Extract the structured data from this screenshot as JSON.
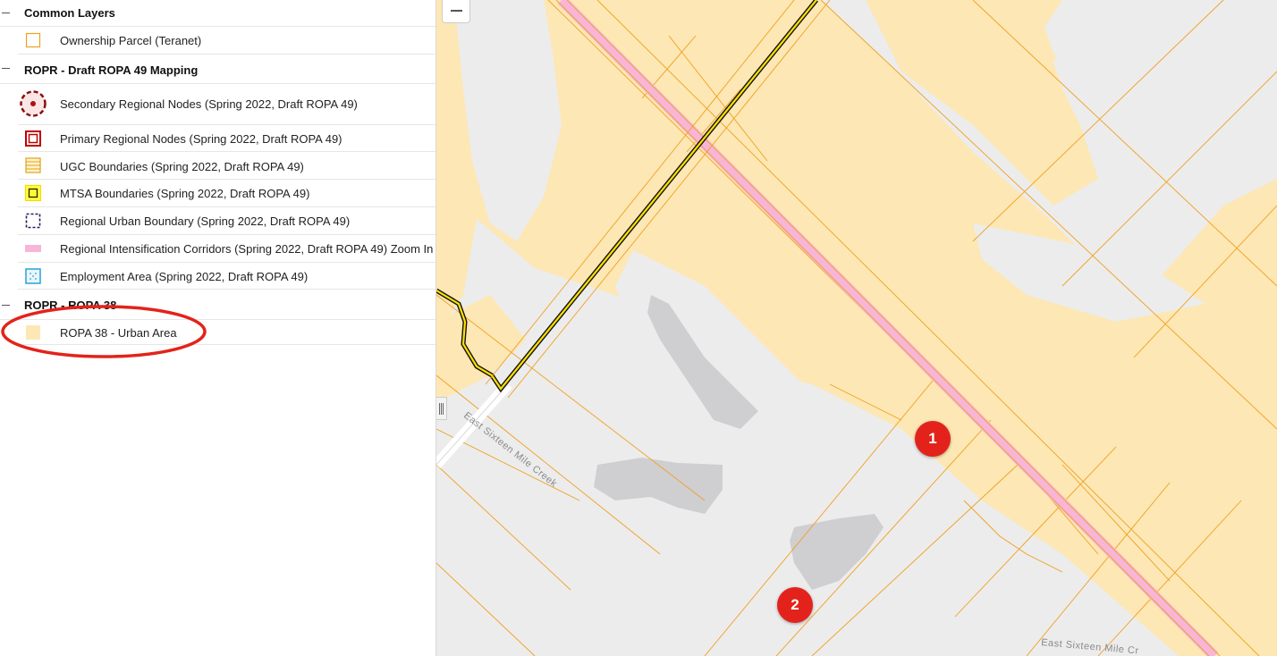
{
  "legend": {
    "groups": [
      {
        "title": "Common Layers",
        "layers": [
          {
            "label": "Ownership Parcel (Teranet)",
            "symbol": "ownership-parcel-symbol-icon"
          }
        ]
      },
      {
        "title": "ROPR - Draft ROPA 49 Mapping",
        "layers": [
          {
            "label": "Secondary Regional Nodes (Spring 2022, Draft ROPA 49)",
            "symbol": "secondary-node-symbol-icon"
          },
          {
            "label": "Primary Regional Nodes (Spring 2022, Draft ROPA 49)",
            "symbol": "primary-node-symbol-icon"
          },
          {
            "label": "UGC Boundaries (Spring 2022, Draft ROPA 49)",
            "symbol": "ugc-boundary-symbol-icon"
          },
          {
            "label": "MTSA Boundaries (Spring 2022, Draft ROPA 49)",
            "symbol": "mtsa-boundary-symbol-icon"
          },
          {
            "label": "Regional Urban Boundary (Spring 2022, Draft ROPA 49)",
            "symbol": "urban-boundary-symbol-icon"
          },
          {
            "label": "Regional Intensification Corridors (Spring 2022, Draft ROPA 49) Zoom In",
            "symbol": "corridor-symbol-icon"
          },
          {
            "label": "Employment Area (Spring 2022, Draft ROPA 49)",
            "symbol": "employment-area-symbol-icon"
          }
        ]
      },
      {
        "title": "ROPR - ROPA 38",
        "layers": [
          {
            "label": "ROPA 38 - Urban Area",
            "symbol": "urban-area-symbol-icon"
          }
        ]
      }
    ]
  },
  "map": {
    "labels": {
      "creek_diag": "East Sixteen Mile Creek",
      "creek_bottom": "East Sixteen Mile Cr"
    },
    "markers": [
      "1",
      "2"
    ],
    "colors": {
      "urban_area": "#fde7b4",
      "parcel_line": "#f0a020",
      "corridor": "#f7b5d8",
      "water": "#cfcfd2",
      "base": "#ececec",
      "annotation": "#e3231b"
    }
  }
}
